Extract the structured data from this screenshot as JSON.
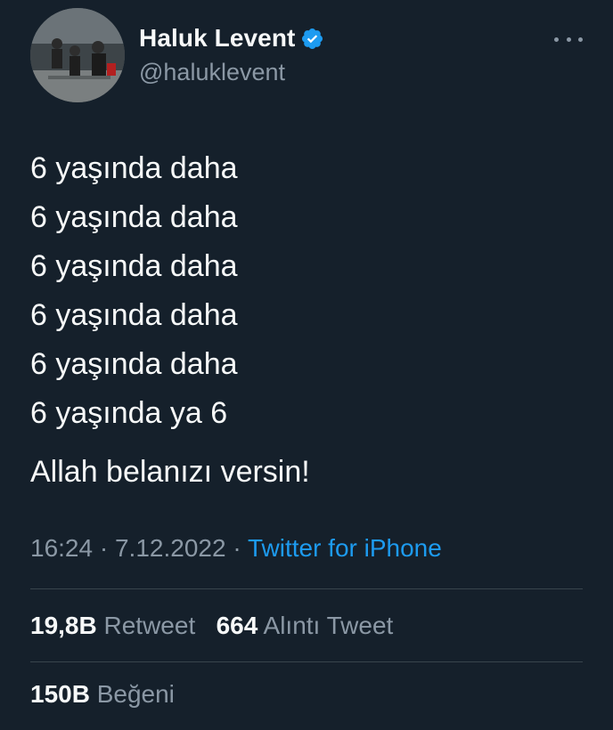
{
  "author": {
    "display_name": "Haluk Levent",
    "handle": "@haluklevent",
    "verified_icon": "verified-badge-icon",
    "accent_color": "#1d9bf0"
  },
  "tweet": {
    "lines": [
      "6 yaşında daha",
      "6 yaşında daha",
      "6 yaşında daha",
      "6 yaşında daha",
      "6 yaşında daha",
      "6 yaşında ya 6"
    ],
    "closing": "Allah belanızı versin!",
    "time": "16:24",
    "separator": "·",
    "date": "7.12.2022",
    "source": "Twitter for iPhone"
  },
  "stats": {
    "retweets_count": "19,8B",
    "retweets_label": "Retweet",
    "quotes_count": "664",
    "quotes_label": "Alıntı Tweet",
    "likes_count": "150B",
    "likes_label": "Beğeni"
  }
}
